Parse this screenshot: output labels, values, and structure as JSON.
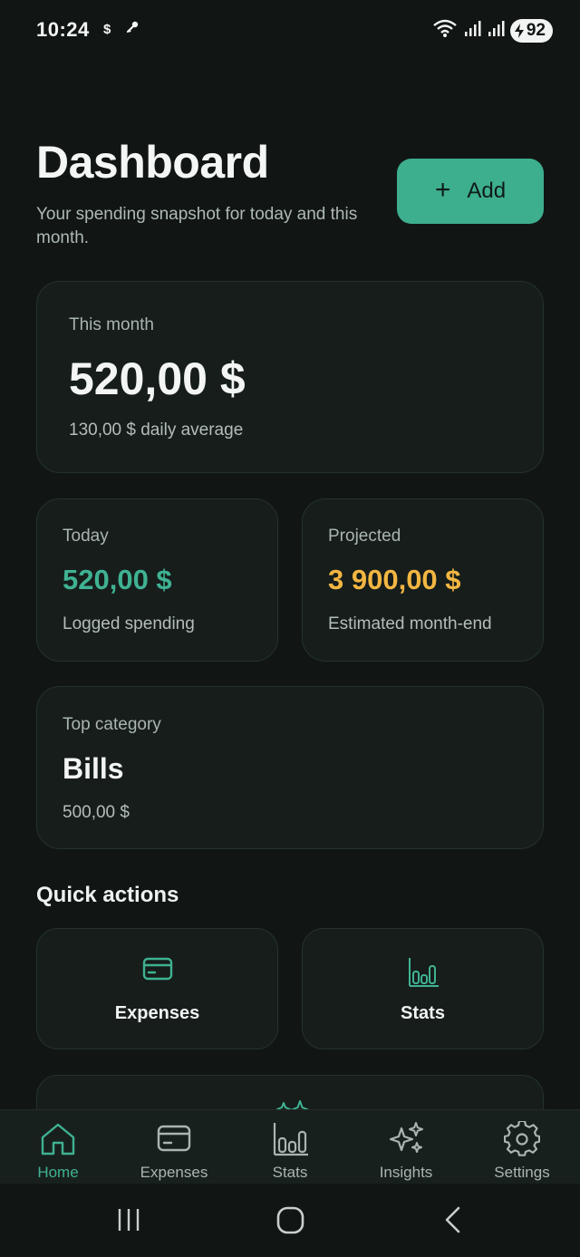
{
  "status_bar": {
    "time": "10:24",
    "notification_icon": "$",
    "battery": "92",
    "icons": [
      "key-icon",
      "wifi-icon",
      "signal-icon",
      "signal-icon",
      "battery-charging-icon"
    ]
  },
  "header": {
    "title": "Dashboard",
    "subtitle": "Your spending snapshot for today and this month.",
    "add_button": {
      "icon": "+",
      "label": "Add"
    }
  },
  "summary": {
    "month": {
      "label": "This month",
      "amount": "520,00 $",
      "detail": "130,00 $ daily average"
    },
    "today": {
      "label": "Today",
      "amount": "520,00 $",
      "detail": "Logged spending"
    },
    "projected": {
      "label": "Projected",
      "amount": "3 900,00 $",
      "detail": "Estimated month-end"
    },
    "top_category": {
      "label": "Top category",
      "name": "Bills",
      "amount": "500,00 $"
    }
  },
  "quick_actions": {
    "title": "Quick actions",
    "items": [
      {
        "label": "Expenses",
        "icon": "credit-card-icon"
      },
      {
        "label": "Stats",
        "icon": "bar-chart-icon"
      },
      {
        "label": "",
        "icon": "sparkles-icon"
      }
    ]
  },
  "bottom_nav": {
    "items": [
      {
        "label": "Home",
        "icon": "home-icon",
        "active": true
      },
      {
        "label": "Expenses",
        "icon": "credit-card-icon",
        "active": false
      },
      {
        "label": "Stats",
        "icon": "bar-chart-icon",
        "active": false
      },
      {
        "label": "Insights",
        "icon": "sparkles-icon",
        "active": false
      },
      {
        "label": "Settings",
        "icon": "gear-icon",
        "active": false
      }
    ]
  },
  "colors": {
    "background": "#111615",
    "card": "#161d1b",
    "accent": "#3dae8e",
    "positive": "#3fb292",
    "warning": "#f2b642",
    "muted_text": "#aab5b0"
  }
}
